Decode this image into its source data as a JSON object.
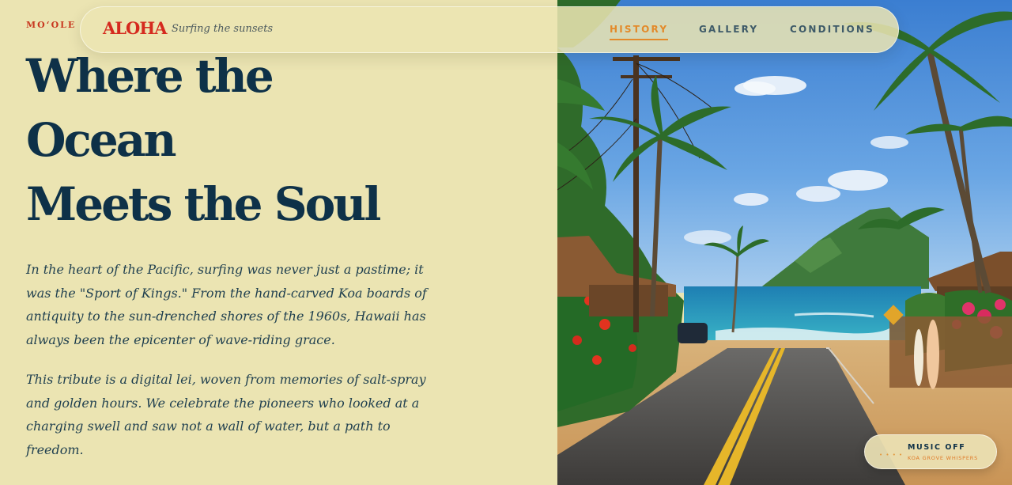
{
  "brand": {
    "kicker": "MO‘OLE",
    "name": "ALOHA",
    "tagline": "Surfing the sunsets"
  },
  "nav": {
    "links": [
      {
        "label": "HISTORY",
        "active": true
      },
      {
        "label": "GALLERY",
        "active": false
      },
      {
        "label": "CONDITIONS",
        "active": false
      }
    ]
  },
  "hero": {
    "title_lines": [
      "Where the",
      "Ocean",
      "Meets the Soul"
    ],
    "paragraphs": [
      "In the heart of the Pacific, surfing was never just a pastime; it was the \"Sport of Kings.\" From the hand-carved Koa boards of antiquity to the sun-drenched shores of the 1960s, Hawaii has always been the epicenter of wave-riding grace.",
      "This tribute is a digital lei, woven from memories of salt-spray and golden hours. We celebrate the pioneers who looked at a charging swell and saw not a wall of water, but a path to freedom."
    ]
  },
  "music": {
    "status": "MUSIC OFF",
    "track": "KOA GROVE WHISPERS",
    "indicator": "• • • •"
  },
  "colors": {
    "background": "#ebe4b2",
    "heading": "#0e3148",
    "brand_red": "#d52a1e",
    "accent_orange": "#e38a2a"
  },
  "scene": {
    "description_icon": "tropical-road-photo"
  }
}
